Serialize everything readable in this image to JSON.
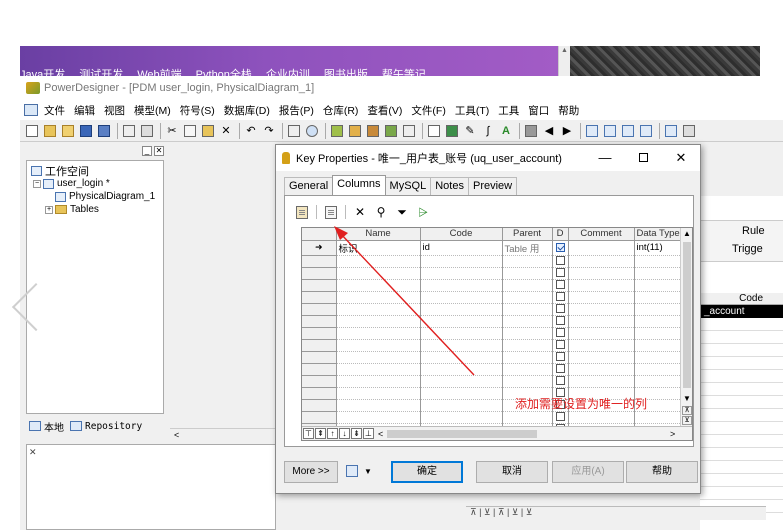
{
  "banner": {
    "items": [
      "Java开发",
      "测试开发",
      "Web前端",
      "Python全栈",
      "企业内训",
      "图书出版",
      "帮午等记"
    ]
  },
  "app": {
    "title": "PowerDesigner - [PDM user_login, PhysicalDiagram_1]",
    "menu": [
      "文件",
      "编辑",
      "视图",
      "模型(M)",
      "符号(S)",
      "数据库(D)",
      "报告(P)",
      "仓库(R)",
      "查看(V)",
      "文件(F)",
      "工具(T)",
      "工具",
      "窗口",
      "帮助"
    ]
  },
  "tree": {
    "workspace": "工作空间",
    "model": "user_login *",
    "diagram": "PhysicalDiagram_1",
    "tables": "Tables"
  },
  "left_tabs": {
    "local": "本地",
    "repository": "Repository"
  },
  "background": {
    "rule": "Rule",
    "trigger": "Trigge",
    "code_header": "Code",
    "code_selected": "_account"
  },
  "dialog": {
    "title": "Key Properties - 唯一_用户表_账号 (uq_user_account)",
    "tabs": [
      "General",
      "Columns",
      "MySQL",
      "Notes",
      "Preview"
    ],
    "active_tab": "Columns",
    "columns": [
      "Name",
      "Code",
      "Parent",
      "D",
      "Comment",
      "Data Type"
    ],
    "rows": [
      {
        "marker": "➜",
        "name": "标识",
        "code": "id",
        "parent": "Table 用",
        "d": true,
        "comment": "",
        "type": "int(11)"
      }
    ],
    "empty_rows": 15,
    "annotation": "添加需要设置为唯一的列",
    "buttons": {
      "more": "More >>",
      "ok": "确定",
      "cancel": "取消",
      "apply": "应用(A)",
      "help": "帮助"
    }
  },
  "icons": {
    "minimize": "—",
    "close": "✕"
  }
}
